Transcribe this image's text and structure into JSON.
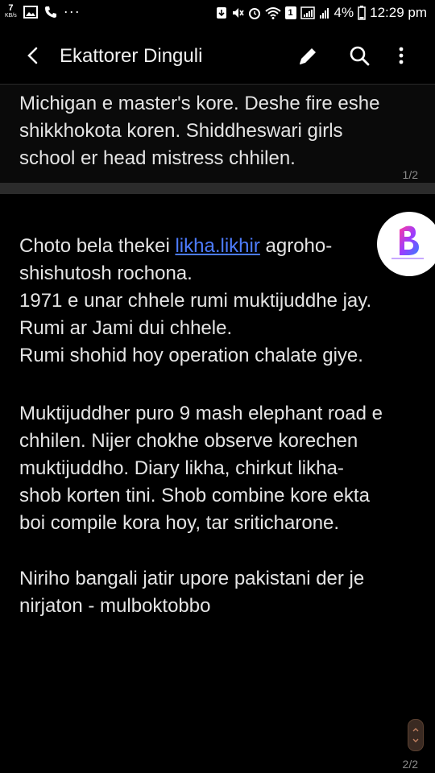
{
  "status_bar": {
    "net_speed_value": "7",
    "net_speed_unit": "KB/s",
    "more_dots": "···",
    "sim_badge": "1",
    "battery_percent": "4%",
    "time": "12:29 pm"
  },
  "app_bar": {
    "title": "Ekattorer Dinguli"
  },
  "page1": {
    "lines": [
      "Michigan e master's kore. Deshe fire eshe",
      "shikkhokota koren. Shiddheswari girls",
      "school er head mistress chhilen."
    ],
    "page_number": "1/2"
  },
  "page2": {
    "para1": {
      "line1_before": "Choto bela thekei ",
      "line1_link": "likha.likhir",
      "line1_after": " agroho-",
      "lines": [
        "shishutosh rochona.",
        "1971 e unar chhele rumi muktijuddhe jay.",
        "Rumi ar Jami dui chhele.",
        "Rumi shohid hoy operation chalate giye."
      ]
    },
    "para2": {
      "lines": [
        "Muktijuddher puro 9 mash elephant road e",
        "chhilen. Nijer chokhe observe korechen",
        "muktijuddho. Diary likha, chirkut likha-",
        "shob korten tini. Shob combine kore ekta",
        "boi compile kora hoy, tar sriticharone."
      ]
    },
    "para3": {
      "lines": [
        "Niriho bangali jatir upore pakistani der je",
        "nirjaton - mulboktobbo"
      ]
    },
    "page_number": "2/2"
  },
  "colors": {
    "background": "#000000",
    "text": "#e4e4e4",
    "link": "#4d7cff",
    "separator": "#2b2b2b",
    "page_number": "#8a8a8a"
  },
  "icons": [
    "image-icon",
    "phone-icon",
    "more-icon",
    "download-icon",
    "mute-icon",
    "alarm-icon",
    "wifi-icon",
    "sim-icon",
    "signal-icon",
    "battery-icon",
    "back-icon",
    "edit-icon",
    "search-icon",
    "overflow-menu-icon",
    "scroll-handle-icon"
  ]
}
